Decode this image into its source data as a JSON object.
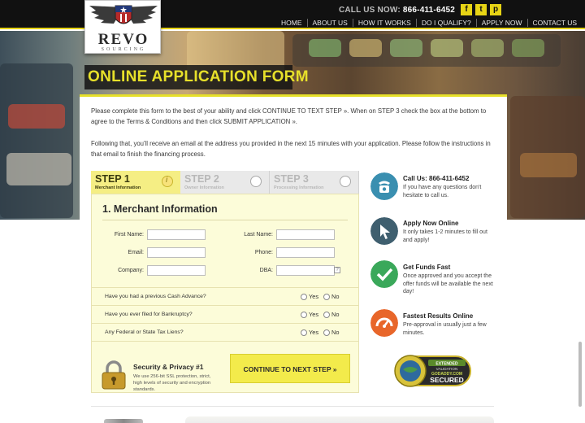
{
  "header": {
    "phone_prefix": "CALL US NOW:",
    "phone_number": "866-411-6452",
    "social": [
      {
        "name": "facebook",
        "glyph": "f"
      },
      {
        "name": "twitter",
        "glyph": "t"
      },
      {
        "name": "pinterest",
        "glyph": "p"
      }
    ],
    "nav": [
      "HOME",
      "ABOUT US",
      "HOW IT WORKS",
      "DO I QUALIFY?",
      "APPLY NOW",
      "CONTACT US"
    ]
  },
  "logo": {
    "word": "REVO",
    "sub": "SOURCING"
  },
  "hero": {
    "title": "ONLINE APPLICATION FORM"
  },
  "intro": {
    "paragraph1": "Please complete this form to the best of your ability and click CONTINUE TO TEXT STEP ». When on STEP 3 check the box at the bottom to agree to the Terms & Conditions and then click SUBMIT APPLICATION ».",
    "paragraph2": "Following that, you'll receive an email at the address you provided in the next 15 minutes with your application. Please follow the instructions in that email to finish the financing process."
  },
  "steps": [
    {
      "label": "STEP 1",
      "sub": "Merchant Information",
      "active": true
    },
    {
      "label": "STEP 2",
      "sub": "Owner Information",
      "active": false
    },
    {
      "label": "STEP 3",
      "sub": "Processing Information",
      "active": false
    }
  ],
  "form": {
    "title": "1. Merchant Information",
    "fields": {
      "first_name": {
        "label": "First Name:",
        "value": ""
      },
      "last_name": {
        "label": "Last Name:",
        "value": ""
      },
      "email": {
        "label": "Email:",
        "value": ""
      },
      "phone": {
        "label": "Phone:",
        "value": ""
      },
      "company": {
        "label": "Company:",
        "value": ""
      },
      "dba": {
        "label": "DBA:",
        "value": ""
      }
    },
    "help_glyph": "?",
    "questions": [
      {
        "text": "Have you had a previous Cash Advance?",
        "yes": "Yes",
        "no": "No"
      },
      {
        "text": "Have you ever filed for Bankruptcy?",
        "yes": "Yes",
        "no": "No"
      },
      {
        "text": "Any Federal or State Tax Liens?",
        "yes": "Yes",
        "no": "No"
      }
    ],
    "security_title": "Security & Privacy #1",
    "security_text": "We use 256-bit SSL protection, strict, high levels of security and encryption standards.",
    "continue_label": "CONTINUE TO NEXT STEP »"
  },
  "features": [
    {
      "title": "Call Us: 866-411-6452",
      "text": "If you have any questions don't hesitate to call us.",
      "icon": "phone-icon",
      "color": "#3a8fb0"
    },
    {
      "title": "Apply Now Online",
      "text": "It only takes 1-2 minutes to fill out and apply!",
      "icon": "cursor-icon",
      "color": "#3f5f6f"
    },
    {
      "title": "Get Funds Fast",
      "text": "Once approved and you accept the offer funds will be available the next day!",
      "icon": "checkmark-icon",
      "color": "#3aa85a"
    },
    {
      "title": "Fastest Results Online",
      "text": "Pre-approval in usually just a few minutes.",
      "icon": "speedometer-icon",
      "color": "#e8662a"
    }
  ],
  "seal": {
    "line1": "EXTENDED",
    "line2": "VALIDATION",
    "brand": "GODADDY.COM",
    "status": "SECURED"
  },
  "colors": {
    "accent_yellow": "#e7e02a",
    "topbar": "#111111",
    "form_bg": "#fcfcd9"
  }
}
